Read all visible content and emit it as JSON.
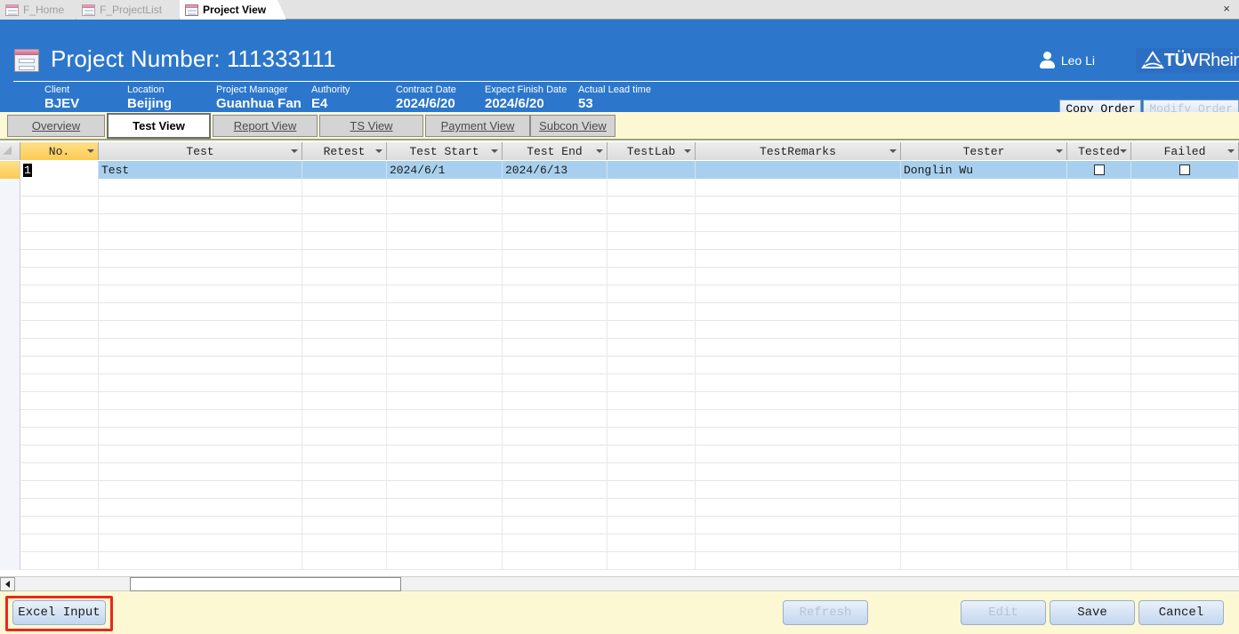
{
  "window": {
    "close_label": "×",
    "doc_tabs": [
      {
        "label": "F_Home",
        "icon": "form-icon",
        "active": false
      },
      {
        "label": "F_ProjectList",
        "icon": "form-icon",
        "active": false
      },
      {
        "label": "Project View",
        "icon": "form-icon",
        "active": true
      }
    ]
  },
  "header": {
    "icon": "form-datasheet-icon",
    "title": "Project Number:",
    "project_number": "111333111",
    "user": {
      "icon": "person-icon",
      "name": "Leo Li"
    },
    "brand": {
      "icon": "tuv-triangle-icon",
      "strong": "TÜV",
      "light": "Rhein"
    },
    "meta": [
      {
        "label": "Client",
        "value": "BJEV"
      },
      {
        "label": "Location",
        "value": "Beijing"
      },
      {
        "label": "Project Manager",
        "value": "Guanhua Fan"
      },
      {
        "label": "Authority",
        "value": "E4"
      },
      {
        "label": "Contract Date",
        "value": "2024/6/20"
      },
      {
        "label": "Expect Finish Date",
        "value": "2024/6/20"
      },
      {
        "label": "Actual Lead time",
        "value": "53"
      }
    ],
    "buttons": [
      {
        "label": "Copy Order",
        "enabled": true
      },
      {
        "label": "Modify Order",
        "enabled": false
      }
    ]
  },
  "view_tabs": [
    {
      "label": "Overview",
      "active": false
    },
    {
      "label": "Test View",
      "active": true
    },
    {
      "label": "Report View",
      "active": false
    },
    {
      "label": "TS View",
      "active": false
    },
    {
      "label": "Payment View",
      "active": false
    },
    {
      "label": "Subcon View",
      "active": false
    }
  ],
  "grid": {
    "columns": [
      {
        "label": "No.",
        "sorted": true
      },
      {
        "label": "Test",
        "sorted": false
      },
      {
        "label": "Retest",
        "sorted": false
      },
      {
        "label": "Test Start",
        "sorted": false
      },
      {
        "label": "Test End",
        "sorted": false
      },
      {
        "label": "TestLab",
        "sorted": false
      },
      {
        "label": "TestRemarks",
        "sorted": false
      },
      {
        "label": "Tester",
        "sorted": false
      },
      {
        "label": "Tested",
        "sorted": false
      },
      {
        "label": "Failed",
        "sorted": false
      }
    ],
    "rows": [
      {
        "selected": true,
        "no": "1",
        "test": "Test",
        "retest": "",
        "test_start": "2024/6/1",
        "test_end": "2024/6/13",
        "testlab": "",
        "testremarks": "",
        "tester": "Donglin Wu",
        "tested": false,
        "failed": false
      }
    ],
    "empty_row_count": 22
  },
  "scrollbar": {
    "left_arrow": "◄"
  },
  "bottom_bar": {
    "buttons": [
      {
        "label": "Excel Input",
        "enabled": true,
        "highlighted": true
      },
      {
        "label": "Refresh",
        "enabled": false,
        "highlighted": false
      },
      {
        "label": "Edit",
        "enabled": false,
        "highlighted": false
      },
      {
        "label": "Save",
        "enabled": true,
        "highlighted": false
      },
      {
        "label": "Cancel",
        "enabled": true,
        "highlighted": false
      }
    ]
  },
  "colors": {
    "header_blue": "#2c77cb",
    "band_yellow": "#fdf8d4",
    "selection_blue": "#a8d0ee",
    "sorted_gold": "#fbcb53",
    "highlight_red": "#e8291c"
  }
}
